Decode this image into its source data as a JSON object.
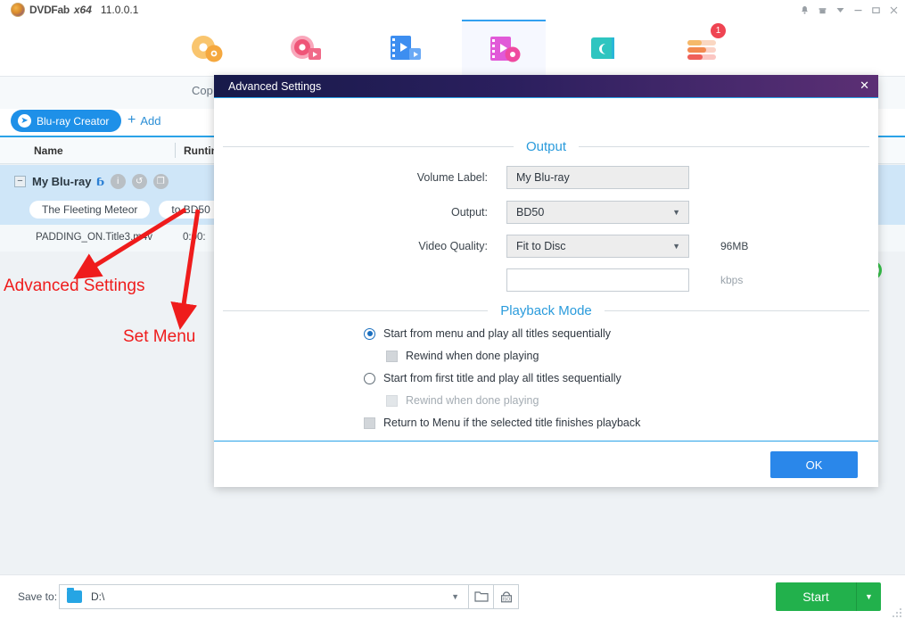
{
  "app": {
    "brand_name": "DVDFab",
    "brand_arch": "x64",
    "version": "11.0.0.1",
    "window_controls": [
      {
        "name": "bell-icon",
        "glyph": "⚑"
      },
      {
        "name": "gift-icon",
        "glyph": "☙"
      },
      {
        "name": "chevron-down-icon",
        "glyph": "▾"
      },
      {
        "name": "minimize-icon",
        "glyph": "─"
      },
      {
        "name": "maximize-icon",
        "glyph": "▭"
      },
      {
        "name": "close-icon",
        "glyph": "✕"
      }
    ]
  },
  "toolbar": {
    "items": [
      {
        "name": "copy-module",
        "active": false
      },
      {
        "name": "ripper-module",
        "active": false
      },
      {
        "name": "video-converter-module",
        "active": false
      },
      {
        "name": "creator-module",
        "active": true
      },
      {
        "name": "utilities-module",
        "active": false
      },
      {
        "name": "task-queue-module",
        "active": false,
        "badge": "1"
      }
    ]
  },
  "tabs": {
    "copy_label": "Cop"
  },
  "actionbar": {
    "mode_label": "Blu-ray Creator",
    "add_label": "Add"
  },
  "table": {
    "columns": [
      {
        "label": "Name"
      },
      {
        "label": "Runtin"
      }
    ],
    "group_row": {
      "name": "My Blu-ray",
      "disc_logo": "ɓ",
      "icons": [
        {
          "name": "info-icon",
          "glyph": "i"
        },
        {
          "name": "refresh-icon",
          "glyph": "↺"
        },
        {
          "name": "menu-settings-icon",
          "glyph": "❐"
        }
      ],
      "chips": [
        "The Fleeting Meteor",
        "to BD50"
      ]
    },
    "sub_row": {
      "name": "PADDING_ON.Title3.m4v",
      "runtime": "0:00:"
    }
  },
  "annotations": [
    {
      "text": "Advanced Settings",
      "name": "annotation-advanced-settings"
    },
    {
      "text": "Set Menu",
      "name": "annotation-set-menu"
    }
  ],
  "bottombar": {
    "save_to_label": "Save to:",
    "path_value": "D:\\",
    "browse_icon": "folder-icon",
    "iso_icon": "iso-icon",
    "start_label": "Start"
  },
  "dialog": {
    "title": "Advanced Settings",
    "close_glyph": "✕",
    "sections": {
      "output": {
        "heading": "Output",
        "fields": [
          {
            "label": "Volume Label:",
            "value": "My Blu-ray",
            "type": "text"
          },
          {
            "label": "Output:",
            "value": "BD50",
            "type": "select"
          },
          {
            "label": "Video Quality:",
            "value": "Fit to Disc",
            "type": "select"
          }
        ],
        "bitrate_value": "",
        "size_note": "96MB",
        "bitrate_unit": "kbps"
      },
      "playback": {
        "heading": "Playback Mode",
        "options": [
          {
            "label": "Start from menu and play all titles sequentially",
            "type": "radio",
            "checked": true,
            "dim": false
          },
          {
            "label": "Rewind when done playing",
            "type": "checkbox",
            "checked": false,
            "dim": false
          },
          {
            "label": "Start from first title and play all titles sequentially",
            "type": "radio",
            "checked": false,
            "dim": false
          },
          {
            "label": "Rewind when done playing",
            "type": "checkbox",
            "checked": false,
            "dim": true
          },
          {
            "label": "Return to Menu if the selected title finishes playback",
            "type": "checkbox",
            "checked": false,
            "dim": false
          }
        ]
      }
    },
    "ok_label": "OK"
  }
}
